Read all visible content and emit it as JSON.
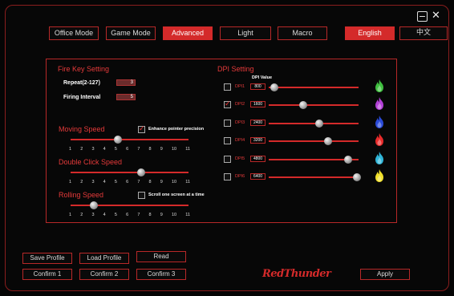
{
  "window": {
    "minimize_glyph": "−",
    "close_glyph": "✕"
  },
  "nav": {
    "office_mode": "Office Mode",
    "game_mode": "Game Mode",
    "advanced": "Advanced",
    "light": "Light",
    "macro": "Macro",
    "english": "English",
    "chinese": "中文",
    "active": "Advanced"
  },
  "fire_key": {
    "title": "Fire Key Setting",
    "repeat_label": "Repeat(2-127)",
    "repeat_value": "3",
    "interval_label": "Firing Interval",
    "interval_value": "5"
  },
  "moving_speed": {
    "title": "Moving Speed",
    "value": 5,
    "max": 11,
    "ticks": [
      "1",
      "2",
      "3",
      "4",
      "5",
      "6",
      "7",
      "8",
      "9",
      "10",
      "11"
    ],
    "enhance_label": "Enhance pointer precision",
    "enhance_checked": true
  },
  "double_click_speed": {
    "title": "Double Click Speed",
    "value": 7,
    "max": 11,
    "ticks": [
      "1",
      "2",
      "3",
      "4",
      "5",
      "6",
      "7",
      "8",
      "9",
      "10",
      "11"
    ]
  },
  "rolling_speed": {
    "title": "Rolling Speed",
    "value": 3,
    "max": 11,
    "ticks": [
      "1",
      "2",
      "3",
      "4",
      "5",
      "6",
      "7",
      "8",
      "9",
      "10",
      "11"
    ],
    "scroll_label": "Scroll one screen at a time",
    "scroll_checked": false
  },
  "dpi": {
    "title": "DPI Setting",
    "value_header": "DPI Value",
    "levels": [
      {
        "label": "DPI1",
        "value": "800",
        "fraction": 0.06,
        "checked": false,
        "flame_color": "#3fbf3f",
        "flame_icon": "green-flame-icon"
      },
      {
        "label": "DPI2",
        "value": "1600",
        "fraction": 0.38,
        "checked": true,
        "flame_color": "#b23fd6",
        "flame_icon": "purple-flame-icon"
      },
      {
        "label": "DPI3",
        "value": "2400",
        "fraction": 0.56,
        "checked": false,
        "flame_color": "#2a4ad8",
        "flame_icon": "blue-flame-icon"
      },
      {
        "label": "DPI4",
        "value": "3200",
        "fraction": 0.66,
        "checked": false,
        "flame_color": "#e82a2a",
        "flame_icon": "red-flame-icon"
      },
      {
        "label": "DPI5",
        "value": "4800",
        "fraction": 0.88,
        "checked": false,
        "flame_color": "#2fb5d8",
        "flame_icon": "cyan-flame-icon"
      },
      {
        "label": "DPI6",
        "value": "6400",
        "fraction": 0.98,
        "checked": false,
        "flame_color": "#f0e02a",
        "flame_icon": "yellow-flame-icon"
      }
    ]
  },
  "actions": {
    "save_profile": "Save Profile",
    "load_profile": "Load Profile",
    "read": "Read",
    "confirm1": "Confirm 1",
    "confirm2": "Confirm 2",
    "confirm3": "Confirm 3",
    "apply": "Apply"
  },
  "brand": "RedThunder"
}
